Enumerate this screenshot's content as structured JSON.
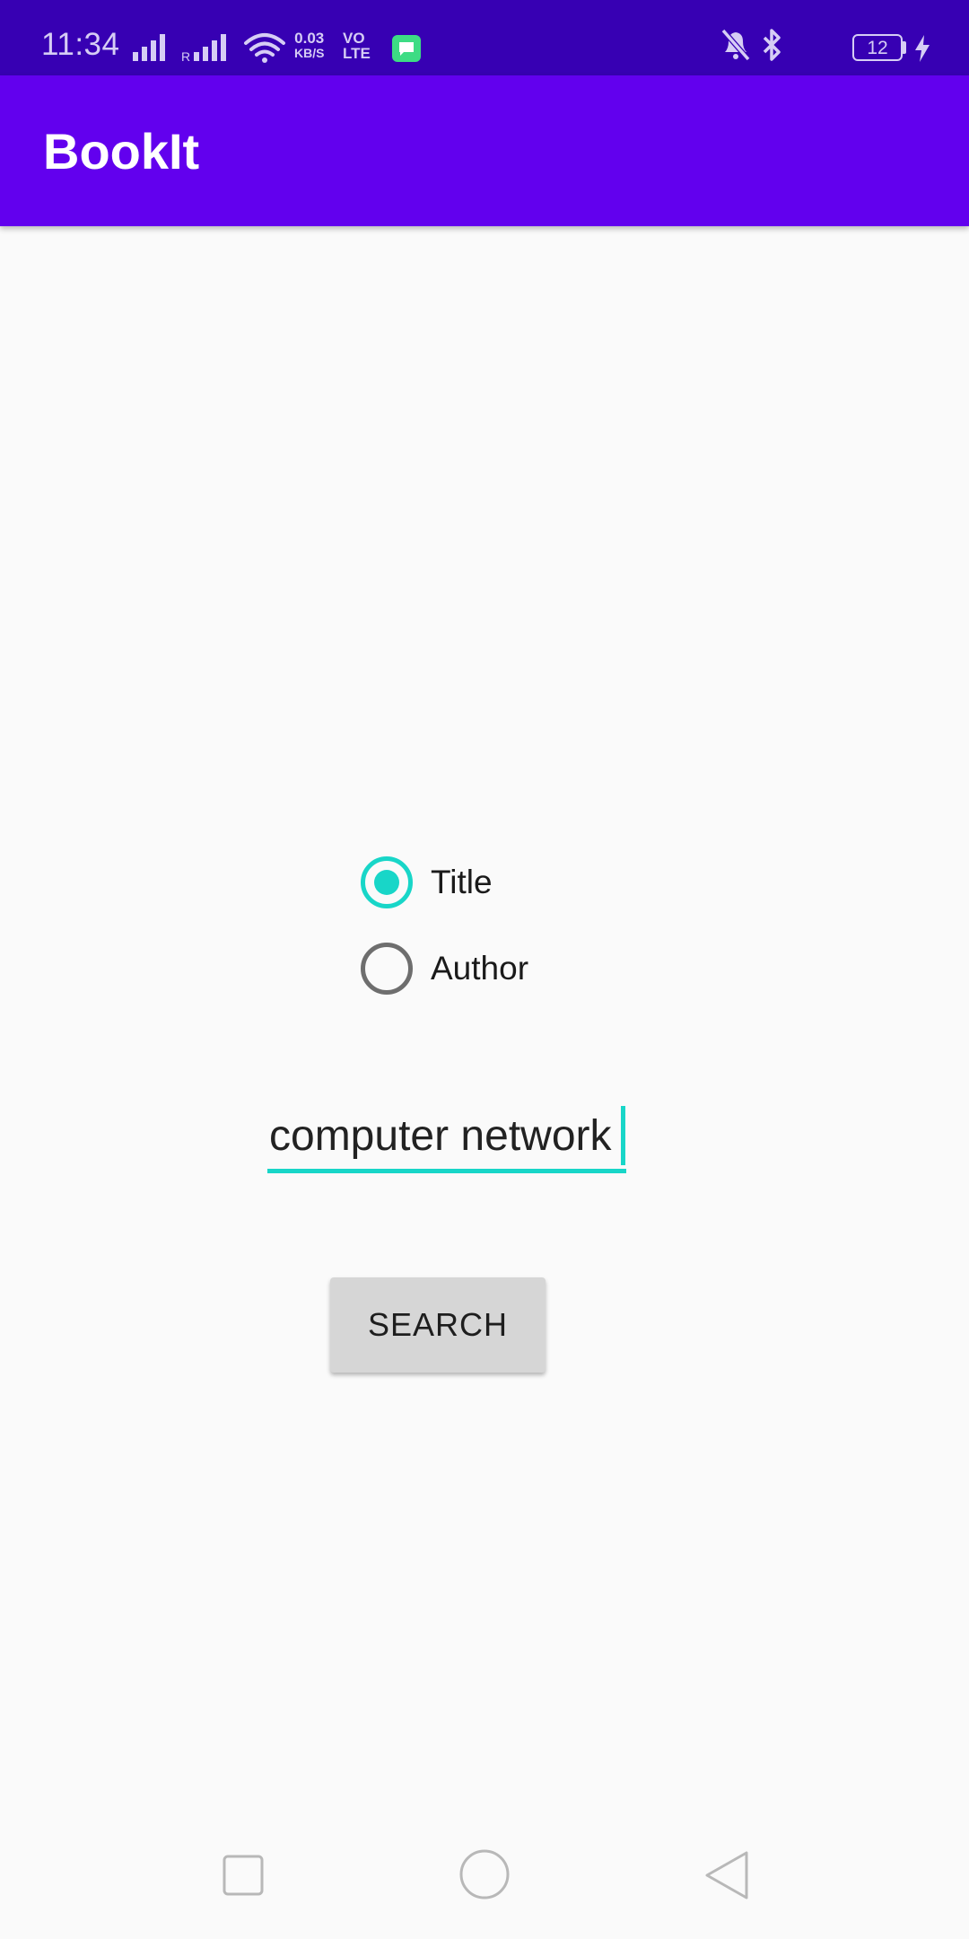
{
  "status_bar": {
    "time": "11:34",
    "net_speed_value": "0.03",
    "net_speed_unit": "KB/S",
    "volte_line1": "VO",
    "volte_line2": "LTE",
    "battery_level": "12",
    "icons": [
      "signal-icon",
      "roaming-signal-icon",
      "wifi-icon",
      "message-notification-icon",
      "mute-icon",
      "bluetooth-icon",
      "battery-icon",
      "charging-icon"
    ]
  },
  "app_bar": {
    "title": "BookIt"
  },
  "search_mode": {
    "options": [
      {
        "label": "Title",
        "checked": true
      },
      {
        "label": "Author",
        "checked": false
      }
    ]
  },
  "search": {
    "query": "computer network"
  },
  "search_button": {
    "label": "SEARCH"
  },
  "nav_bar": {
    "icons": [
      "recents-icon",
      "home-icon",
      "back-icon"
    ]
  },
  "colors": {
    "status_bar": "#3700b3",
    "app_bar": "#6200ee",
    "accent": "#18d6c8",
    "background": "#fafafa",
    "button": "#d6d6d6"
  }
}
